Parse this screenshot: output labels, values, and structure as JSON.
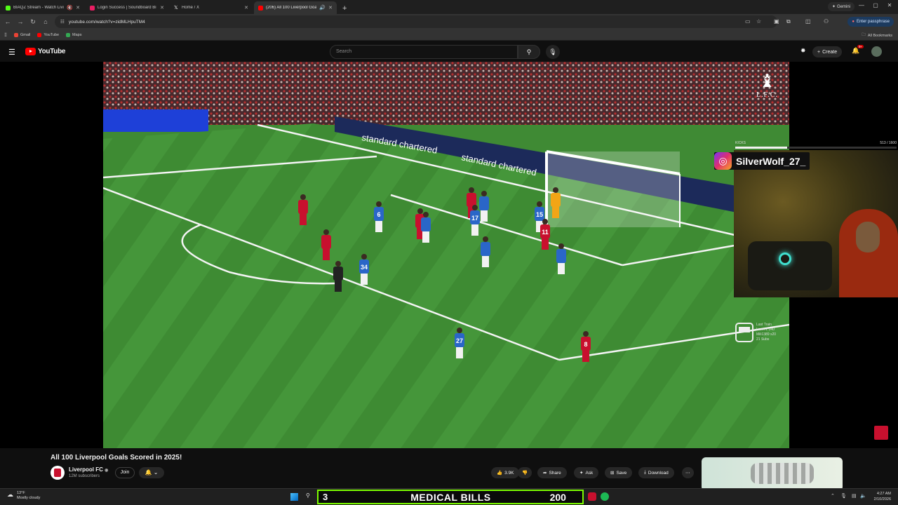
{
  "browser": {
    "tabs": [
      {
        "title": "BIAQZ Stream - Watch Livi",
        "favicon_color": "#53fc18",
        "active": false,
        "muted": true
      },
      {
        "title": "Login Success | Soundboard Bi",
        "favicon_color": "#e91e63",
        "active": false,
        "muted": false
      },
      {
        "title": "Home / X",
        "favicon_color": "#ffffff",
        "active": false,
        "muted": false
      },
      {
        "title": "(206) All 100 Liverpool Goa",
        "favicon_color": "#ff0000",
        "active": true,
        "muted": false
      }
    ],
    "gemini_label": "Gemini",
    "url": "youtube.com/watch?v=zidMLHpuTM4",
    "passphrase_button": "Enter passphrase",
    "bookmarks": [
      {
        "label": "Gmail",
        "color": "#ea4335"
      },
      {
        "label": "YouTube",
        "color": "#ff0000"
      },
      {
        "label": "Maps",
        "color": "#34a853"
      }
    ],
    "all_bookmarks": "All Bookmarks"
  },
  "youtube": {
    "logo_text": "YouTube",
    "search_placeholder": "Search",
    "create_label": "Create",
    "notification_count": "9+"
  },
  "video": {
    "overlay_badge": {
      "crest": "♝",
      "text": "L.F.C."
    },
    "jersey_numbers": [
      "6",
      "17",
      "15",
      "11",
      "34",
      "27",
      "8"
    ]
  },
  "stream_overlay": {
    "kicks_label": "KICKS",
    "kicks_count": "513 / 1600",
    "kicks_progress": 0.32,
    "instagram_handle": "SilverWolf_27_",
    "train_info": [
      "Last Train",
      "Level 2 140",
      "Mili1389 x20",
      "21 Subs"
    ]
  },
  "video_info": {
    "title": "All 100 Liverpool Goals Scored in 2025!",
    "channel_name": "Liverpool FC",
    "verified": "◉",
    "subscribers": "12M subscribers",
    "join_label": "Join",
    "likes": "3.9K",
    "share_label": "Share",
    "ask_label": "Ask",
    "save_label": "Save",
    "download_label": "Download"
  },
  "taskbar": {
    "temperature": "13°F",
    "weather": "Mostly cloudy",
    "banner_left": "3",
    "banner_text": "MEDICAL BILLS",
    "banner_right": "200",
    "time": "4:27 AM",
    "date": "2/10/2026"
  }
}
